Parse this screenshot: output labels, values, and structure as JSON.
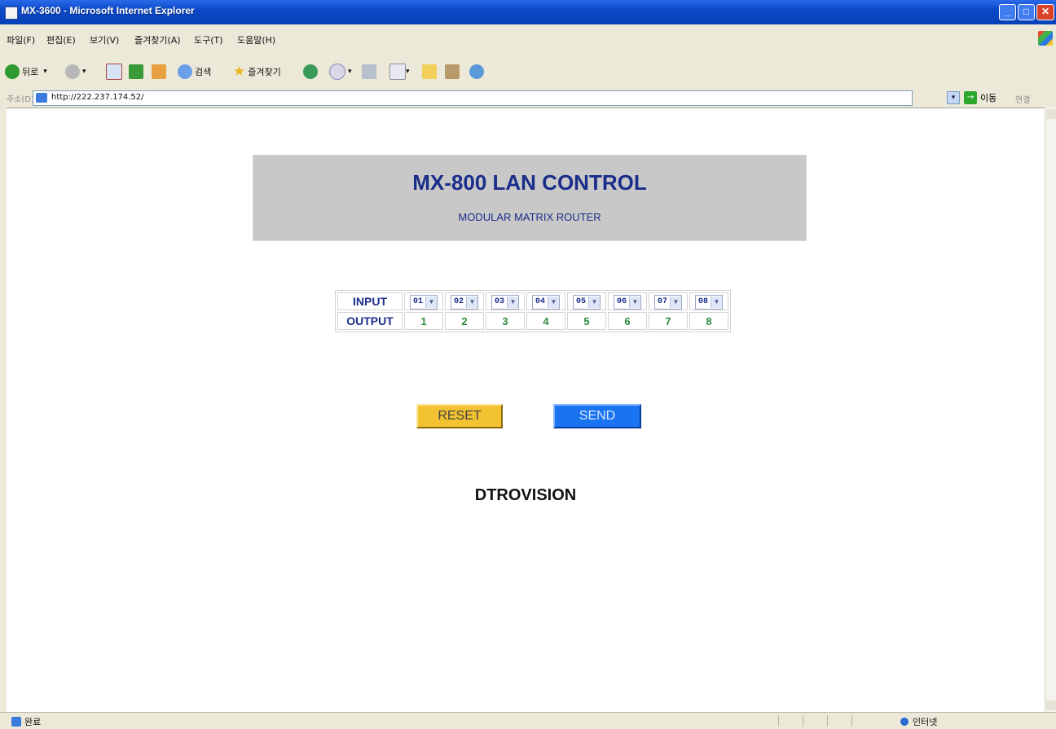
{
  "window": {
    "title": "MX-3600 - Microsoft Internet Explorer"
  },
  "menu": [
    "파일(F)",
    "편집(E)",
    "보기(V)",
    "즐겨찾기(A)",
    "도구(T)",
    "도움말(H)"
  ],
  "toolbar": {
    "back": "뒤로",
    "search": "검색",
    "favorites": "즐겨찾기"
  },
  "address": {
    "label": "주소(D)",
    "url": "http://222.237.174.52/",
    "go": "이동",
    "links": "연결"
  },
  "page": {
    "title": "MX-800  LAN CONTROL",
    "subtitle": "MODULAR  MATRIX ROUTER",
    "input_label": "INPUT",
    "output_label": "OUTPUT",
    "inputs": [
      "01",
      "02",
      "03",
      "04",
      "05",
      "06",
      "07",
      "08"
    ],
    "outputs": [
      "1",
      "2",
      "3",
      "4",
      "5",
      "6",
      "7",
      "8"
    ],
    "reset": "RESET",
    "send": "SEND",
    "brand": "DTROVISION"
  },
  "status": {
    "left": "완료",
    "zone": "인터넷"
  }
}
